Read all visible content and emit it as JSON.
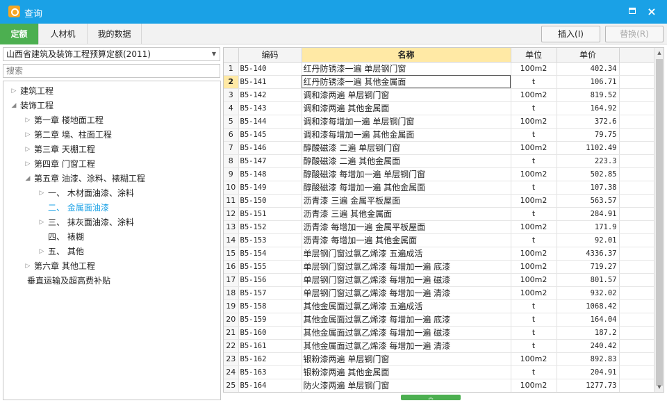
{
  "window": {
    "title": "查询",
    "maximize_label": "",
    "close_label": "×"
  },
  "tabs": [
    "定额",
    "人材机",
    "我的数据"
  ],
  "toolbar": {
    "insert_label": "插入(I)",
    "replace_label": "替换(R)"
  },
  "left": {
    "quota_select": "山西省建筑及装饰工程预算定额(2011)",
    "search_placeholder": "搜索",
    "tree": [
      {
        "label": "建筑工程",
        "level": 0,
        "state": "collapsed"
      },
      {
        "label": "装饰工程",
        "level": 0,
        "state": "expanded"
      },
      {
        "label": "第一章  楼地面工程",
        "level": 1,
        "state": "collapsed"
      },
      {
        "label": "第二章  墙、柱面工程",
        "level": 1,
        "state": "collapsed"
      },
      {
        "label": "第三章  天棚工程",
        "level": 1,
        "state": "collapsed"
      },
      {
        "label": "第四章  门窗工程",
        "level": 1,
        "state": "collapsed"
      },
      {
        "label": "第五章  油漆、涂料、裱糊工程",
        "level": 1,
        "state": "expanded"
      },
      {
        "label": "一、  木材面油漆、涂料",
        "level": 2,
        "state": "collapsed"
      },
      {
        "label": "二、  金属面油漆",
        "level": 2,
        "state": "leaf",
        "selected": true
      },
      {
        "label": "三、  抹灰面油漆、涂料",
        "level": 2,
        "state": "collapsed"
      },
      {
        "label": "四、  裱糊",
        "level": 2,
        "state": "leaf"
      },
      {
        "label": "五、  其他",
        "level": 2,
        "state": "collapsed"
      },
      {
        "label": "第六章  其他工程",
        "level": 1,
        "state": "collapsed"
      },
      {
        "label": "垂直运输及超高费补贴",
        "level": 1,
        "state": "leaf"
      }
    ]
  },
  "grid": {
    "columns": [
      "",
      "编码",
      "名称",
      "单位",
      "单价"
    ],
    "current_row": 2,
    "rows": [
      [
        "1",
        "B5-140",
        "红丹防锈漆一遍 单层钢门窗",
        "100m2",
        "402.34"
      ],
      [
        "2",
        "B5-141",
        "红丹防锈漆一遍 其他金属面",
        "t",
        "106.71"
      ],
      [
        "3",
        "B5-142",
        "调和漆两遍 单层钢门窗",
        "100m2",
        "819.52"
      ],
      [
        "4",
        "B5-143",
        "调和漆两遍 其他金属面",
        "t",
        "164.92"
      ],
      [
        "5",
        "B5-144",
        "调和漆每增加一遍 单层钢门窗",
        "100m2",
        "372.6"
      ],
      [
        "6",
        "B5-145",
        "调和漆每增加一遍 其他金属面",
        "t",
        "79.75"
      ],
      [
        "7",
        "B5-146",
        "醇酸磁漆 二遍 单层钢门窗",
        "100m2",
        "1102.49"
      ],
      [
        "8",
        "B5-147",
        "醇酸磁漆 二遍 其他金属面",
        "t",
        "223.3"
      ],
      [
        "9",
        "B5-148",
        "醇酸磁漆 每增加一遍 单层钢门窗",
        "100m2",
        "502.85"
      ],
      [
        "10",
        "B5-149",
        "醇酸磁漆 每增加一遍 其他金属面",
        "t",
        "107.38"
      ],
      [
        "11",
        "B5-150",
        "沥青漆 三遍 金属平板屋面",
        "100m2",
        "563.57"
      ],
      [
        "12",
        "B5-151",
        "沥青漆 三遍 其他金属面",
        "t",
        "284.91"
      ],
      [
        "13",
        "B5-152",
        "沥青漆 每增加一遍 金属平板屋面",
        "100m2",
        "171.9"
      ],
      [
        "14",
        "B5-153",
        "沥青漆 每增加一遍 其他金属面",
        "t",
        "92.01"
      ],
      [
        "15",
        "B5-154",
        "单层钢门窗过氯乙烯漆 五遍成活",
        "100m2",
        "4336.37"
      ],
      [
        "16",
        "B5-155",
        "单层钢门窗过氯乙烯漆 每增加一遍 底漆",
        "100m2",
        "719.27"
      ],
      [
        "17",
        "B5-156",
        "单层钢门窗过氯乙烯漆 每增加一遍 磁漆",
        "100m2",
        "801.57"
      ],
      [
        "18",
        "B5-157",
        "单层钢门窗过氯乙烯漆 每增加一遍 清漆",
        "100m2",
        "932.02"
      ],
      [
        "19",
        "B5-158",
        "其他金属面过氯乙烯漆 五遍成活",
        "t",
        "1068.42"
      ],
      [
        "20",
        "B5-159",
        "其他金属面过氯乙烯漆 每增加一遍 底漆",
        "t",
        "164.04"
      ],
      [
        "21",
        "B5-160",
        "其他金属面过氯乙烯漆 每增加一遍 磁漆",
        "t",
        "187.2"
      ],
      [
        "22",
        "B5-161",
        "其他金属面过氯乙烯漆 每增加一遍 清漆",
        "t",
        "240.42"
      ],
      [
        "23",
        "B5-162",
        "银粉漆两遍 单层钢门窗",
        "100m2",
        "892.83"
      ],
      [
        "24",
        "B5-163",
        "银粉漆两遍 其他金属面",
        "t",
        "204.91"
      ],
      [
        "25",
        "B5-164",
        "防火漆两遍 单层钢门窗",
        "100m2",
        "1277.73"
      ]
    ]
  },
  "colors": {
    "titlebar": "#1aa1e6",
    "active_tab": "#4caf50",
    "header_highlight": "#ffe9a5",
    "selected_tree": "#1aa1e6"
  },
  "icons": {
    "app": "app-logo-icon",
    "maximize": "maximize-icon",
    "close": "close-icon",
    "expand": "expand-arrow-icon",
    "dropdown": "dropdown-arrow-icon",
    "splitter": "collapse-up-icon"
  }
}
